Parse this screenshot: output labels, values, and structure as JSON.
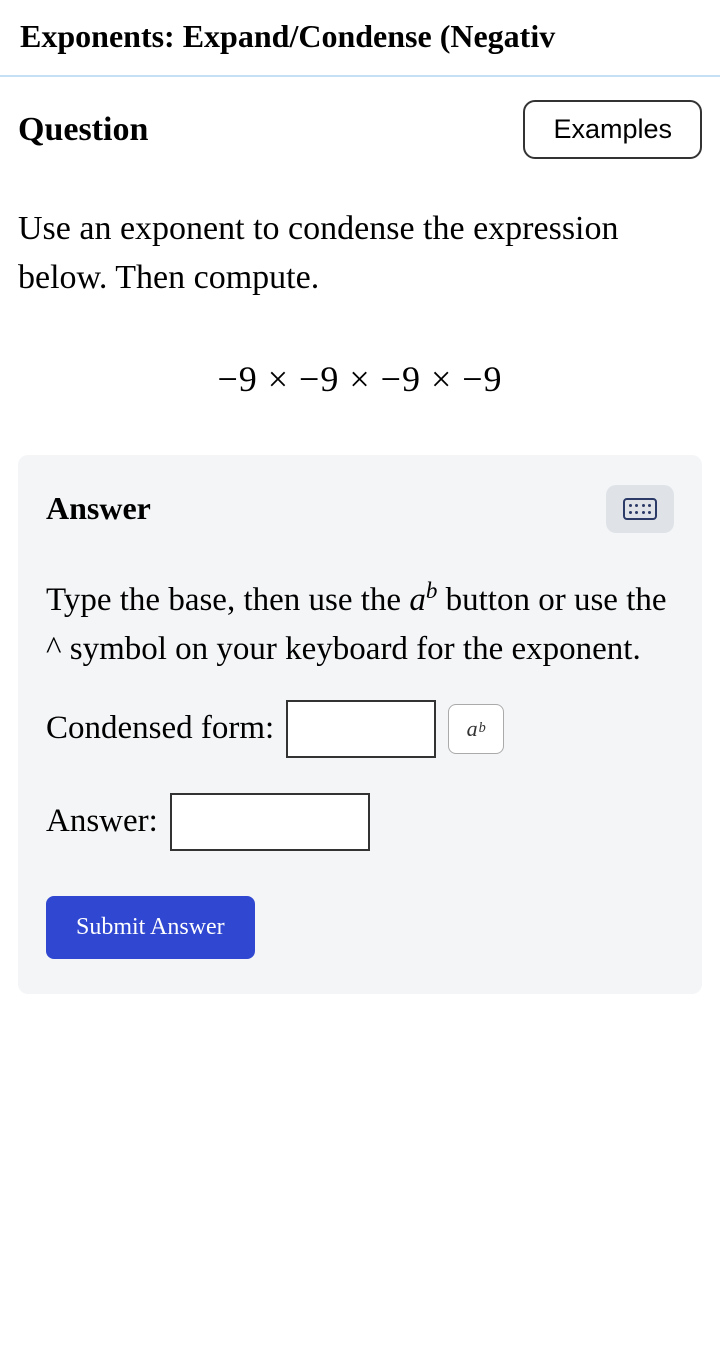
{
  "pageTitle": "Exponents: Expand/Condense (Negativ",
  "header": {
    "questionLabel": "Question",
    "examplesLabel": "Examples"
  },
  "instruction": "Use an exponent to condense the expression below. Then compute.",
  "expression": "−9 × −9 × −9 × −9",
  "answer": {
    "heading": "Answer",
    "instructionPart1": "Type the base, then use the ",
    "instructionPart2": " button or use the ^ symbol on your keyboard for the exponent.",
    "condensedLabel": "Condensed form:",
    "answerLabel": "Answer:",
    "submitLabel": "Submit Answer",
    "exponentButtonBase": "a",
    "exponentButtonExp": "b",
    "condensedValue": "",
    "answerValue": ""
  }
}
